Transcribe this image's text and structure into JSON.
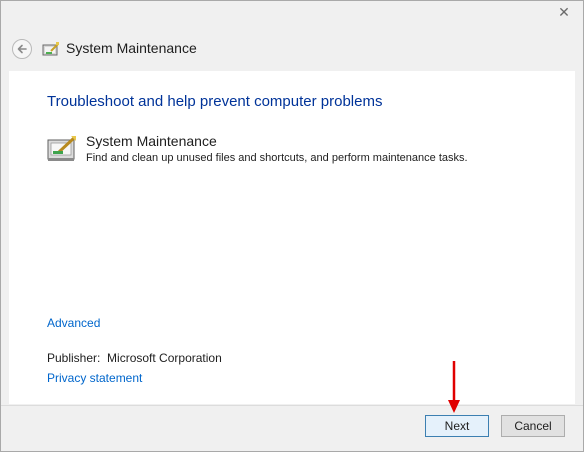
{
  "window": {
    "title": "System Maintenance"
  },
  "content": {
    "heading": "Troubleshoot and help prevent computer problems",
    "task_title": "System Maintenance",
    "task_description": "Find and clean up unused files and shortcuts, and perform maintenance tasks.",
    "advanced_link": "Advanced",
    "publisher_label": "Publisher:",
    "publisher_value": "Microsoft Corporation",
    "privacy_link": "Privacy statement"
  },
  "footer": {
    "next_label": "Next",
    "cancel_label": "Cancel"
  },
  "icons": {
    "close": "close-icon",
    "back": "back-arrow-icon",
    "maintenance": "system-maintenance-icon",
    "annotation": "red-arrow-annotation"
  },
  "colors": {
    "heading": "#003399",
    "link": "#0066cc",
    "annotation": "#e00000"
  }
}
